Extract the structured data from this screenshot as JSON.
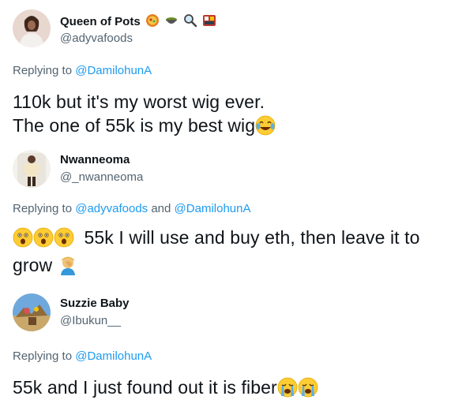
{
  "tweets": [
    {
      "name": "Queen of Pots",
      "name_emojis": [
        "pot-of-food-emoji",
        "bowl-emoji",
        "magnifying-glass-emoji",
        "bento-box-emoji"
      ],
      "handle": "@adyvafoods",
      "replying_prefix": "Replying to",
      "replying_to": [
        "@DamilohunA"
      ],
      "text_lines": [
        "110k but it's my worst wig ever.",
        "The one of 55k is my best wig"
      ],
      "trailing_emoji": "face-with-tears-of-joy-emoji"
    },
    {
      "name": "Nwanneoma",
      "handle": "@_nwanneoma",
      "replying_prefix": "Replying to",
      "replying_to": [
        "@adyvafoods",
        "@DamilohunA"
      ],
      "replying_joiner": "and",
      "leading_emojis": [
        "astonished-face-emoji",
        "astonished-face-emoji",
        "astonished-face-emoji"
      ],
      "text_line1": "55k I will use and buy eth, then leave it to",
      "text_line2": "grow",
      "trailing_emoji": "person-facepalming-emoji"
    },
    {
      "name": "Suzzie Baby",
      "handle": "@Ibukun__",
      "replying_prefix": "Replying to",
      "replying_to": [
        "@DamilohunA"
      ],
      "text": "55k and I just found out it is fiber",
      "trailing_emojis": [
        "loudly-crying-face-emoji",
        "loudly-crying-face-emoji"
      ]
    }
  ],
  "colors": {
    "text": "#0f1419",
    "secondary": "#536471",
    "mention": "#1d9bf0"
  }
}
